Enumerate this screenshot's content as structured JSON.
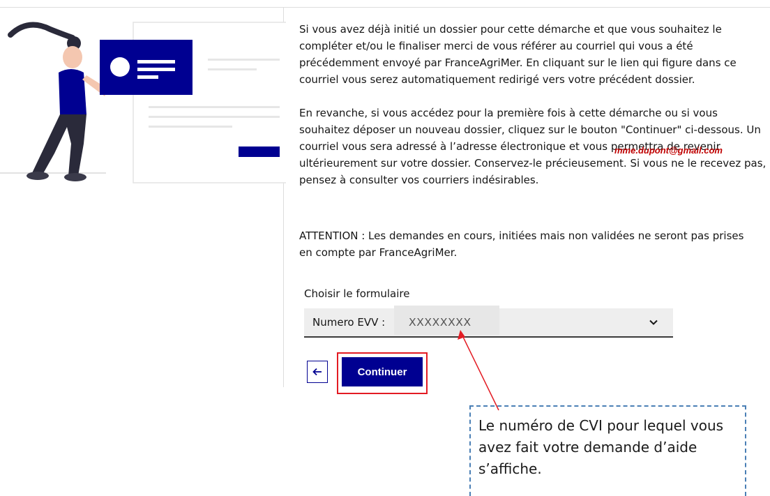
{
  "intro": {
    "paragraph1": "Si vous avez déjà initié un dossier pour cette démarche et que vous souhaitez le compléter et/ou le finaliser merci de vous référer au courriel qui vous a été précédemment envoyé par FranceAgriMer. En cliquant sur le lien qui figure dans ce courriel vous serez automatiquement redirigé vers votre précédent dossier.",
    "paragraph2": "En revanche, si vous accédez pour la première fois à cette démarche ou si vous souhaitez déposer un nouveau dossier, cliquez sur le bouton \"Continuer\" ci-dessous. Un courriel vous sera adressé à l’adresse électronique  et vous permettra de revenir ultérieurement sur votre dossier. Conservez-le précieusement. Si vous ne le recevez pas, pensez à consulter vos courriers indésirables.",
    "paragraph3": "ATTENTION : Les demandes en cours, initiées mais non validées ne seront pas prises en compte par FranceAgriMer.",
    "email": "mme.dupont@gmail.com"
  },
  "form": {
    "label": "Choisir le formulaire",
    "select_prefix": "Numero EVV :",
    "select_value": "XXXXXXXX"
  },
  "buttons": {
    "continue_label": "Continuer"
  },
  "annotation": {
    "text": "Le numéro de CVI pour lequel vous avez fait votre demande d’aide s’affiche."
  },
  "colors": {
    "primary_blue": "#000091",
    "highlight_red": "#e31b23",
    "email_red": "#c00000",
    "callout_border": "#4a7fb5"
  },
  "icons": {
    "back": "arrow-left-icon",
    "dropdown": "chevron-down-icon"
  }
}
